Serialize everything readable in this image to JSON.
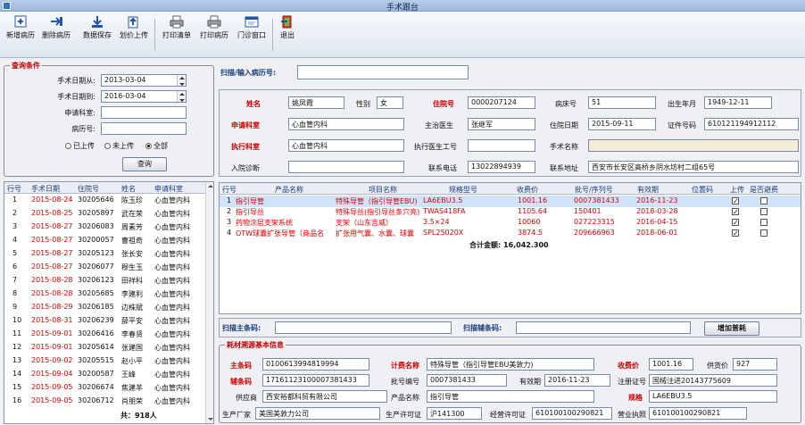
{
  "window": {
    "title": "手术跟台"
  },
  "toolbar": [
    {
      "label": "新增病历",
      "icon": "new-record-icon"
    },
    {
      "label": "删除病历",
      "icon": "delete-record-icon"
    },
    {
      "label": "数据保存",
      "icon": "save-data-icon"
    },
    {
      "label": "划价上传",
      "icon": "upload-pricing-icon"
    },
    {
      "label": "打印清单",
      "icon": "print-list-icon"
    },
    {
      "label": "打印病历",
      "icon": "print-record-icon"
    },
    {
      "label": "门诊窗口",
      "icon": "outpatient-window-icon"
    },
    {
      "label": "退出",
      "icon": "exit-icon"
    }
  ],
  "query": {
    "legend": "查询条件",
    "date_from_label": "手术日期从:",
    "date_from": "2013-03-04",
    "date_to_label": "手术日期到:",
    "date_to": "2016-03-04",
    "dept_label": "申请科室:",
    "dept": "",
    "record_label": "病历号:",
    "record": "",
    "radio_uploaded": "已上传",
    "radio_not_uploaded": "未上传",
    "radio_all": "全部",
    "selected": "全部",
    "search_button": "查询"
  },
  "surgery_list": {
    "headers": [
      "行号",
      "手术日期",
      "住院号",
      "姓名",
      "申请科室"
    ],
    "rows": [
      [
        "1",
        "2015-08-24",
        "30205646",
        "陈玉珍",
        "心血管内科"
      ],
      [
        "2",
        "2015-08-25",
        "30205897",
        "武在荣",
        "心血管内科"
      ],
      [
        "3",
        "2015-08-27",
        "30206083",
        "周素芳",
        "心血管内科"
      ],
      [
        "4",
        "2015-08-27",
        "30200057",
        "曹祖奇",
        "心血管内科"
      ],
      [
        "5",
        "2015-08-27",
        "30205123",
        "张长安",
        "心血管内科"
      ],
      [
        "6",
        "2015-08-27",
        "30206077",
        "穆生玉",
        "心血管内科"
      ],
      [
        "7",
        "2015-08-28",
        "30206123",
        "田祥科",
        "心血管内科"
      ],
      [
        "8",
        "2015-08-28",
        "30205685",
        "李建利",
        "心血管内科"
      ],
      [
        "9",
        "2015-08-29",
        "30206185",
        "边株斌",
        "心血管内科"
      ],
      [
        "10",
        "2015-08-31",
        "30206239",
        "薛平安",
        "心血管内科"
      ],
      [
        "11",
        "2015-09-01",
        "30206416",
        "李春贤",
        "心血管内科"
      ],
      [
        "12",
        "2015-09-01",
        "30205614",
        "张建国",
        "心血管内科"
      ],
      [
        "13",
        "2015-09-02",
        "30205515",
        "赵小平",
        "心血管内科"
      ],
      [
        "14",
        "2015-09-04",
        "30200587",
        "王峰",
        "心血管内科"
      ],
      [
        "15",
        "2015-09-05",
        "30206674",
        "焦建羊",
        "心血管内科"
      ],
      [
        "16",
        "2015-09-05",
        "30206712",
        "肖朋荣",
        "心血管内科"
      ]
    ],
    "total": "共：918人"
  },
  "scan_record": {
    "label": "扫描/输入病历号:",
    "value": ""
  },
  "patient": {
    "name_label": "姓名",
    "name": "姚凤霞",
    "sex_label": "性别",
    "sex": "女",
    "inpatient_label": "住院号",
    "inpatient": "0000207124",
    "bed_label": "病床号",
    "bed": "51",
    "birth_label": "出生年月",
    "birth": "1949-12-11",
    "dept_label": "申请科室",
    "dept": "心血管内科",
    "doctor_label": "主治医生",
    "doctor": "张继军",
    "admit_label": "住院日期",
    "admit": "2015-09-11",
    "id_label": "证件号码",
    "id": "610121194912112",
    "exec_dept_label": "执行科室",
    "exec_dept": "心血管内科",
    "exec_doc_label": "执行医生工号",
    "exec_doc": "",
    "surgery_label": "手术名称",
    "surgery": "",
    "diag_label": "入院诊断",
    "diag": "",
    "phone_label": "联系电话",
    "phone": "13022894939",
    "addr_label": "联系地址",
    "addr": "西安市长安区高桥乡阴水坊村二组65号"
  },
  "items": {
    "headers": [
      "行号",
      "产品名称",
      "项目名称",
      "规格型号",
      "收费价",
      "批号/序列号",
      "有效期",
      "位置码",
      "上传",
      "是否避费"
    ],
    "rows": [
      {
        "no": "1",
        "product": "指引导管",
        "project": "特殊导管（指引导管EBU)",
        "spec": "LA6EBU3.5",
        "price": "1001.16",
        "lot": "0007381433",
        "expiry": "2016-11-23",
        "loc": "",
        "uploaded": true,
        "waived": false
      },
      {
        "no": "2",
        "product": "指引导丝",
        "project": "特殊导丝(指引导丝条穴亮)",
        "spec": "TWAS418FA",
        "price": "1105.64",
        "lot": "150401",
        "expiry": "2018-03-28",
        "loc": "",
        "uploaded": true,
        "waived": false
      },
      {
        "no": "3",
        "product": "药物涂层支架系统",
        "project": "支架（山东吉威）",
        "spec": "3.5×24",
        "price": "10060",
        "lot": "027223315",
        "expiry": "2016-04-15",
        "loc": "",
        "uploaded": true,
        "waived": false
      },
      {
        "no": "4",
        "product": "OTW球囊扩张导管（商品名",
        "project": "扩张用气囊、水囊、球囊",
        "spec": "SPL25020X",
        "price": "3874.5",
        "lot": "209666963",
        "expiry": "2018-06-01",
        "loc": "",
        "uploaded": true,
        "waived": false
      }
    ],
    "total_label": "合计金额:",
    "total": "16,042.300"
  },
  "scan_bar": {
    "main_label": "扫描主条码:",
    "main_value": "",
    "aux_label": "扫描辅条码:",
    "aux_value": "",
    "add_button": "增加普耗"
  },
  "consumable": {
    "legend": "耗材溯源基本信息",
    "code_label": "主条码",
    "code": "0100613994819994",
    "charge_name_label": "计费名称",
    "charge_name": "特殊导管（指引导管EBU美敦力)",
    "price_label": "收费价",
    "price": "1001.16",
    "supply_price_label": "供货价",
    "supply_price": "927",
    "aux_code_label": "辅条码",
    "aux_code": "17161123100007381433",
    "lot_label": "批号编号",
    "lot": "0007381433",
    "expiry_label": "有效期",
    "expiry": "2016-11-23",
    "reg_label": "注册证号",
    "reg": "国械注进20143775609",
    "supplier_label": "供应商",
    "supplier": "西安裕都科贸有限公司",
    "product_label": "产品名称",
    "product": "指引导管",
    "spec_label": "规格",
    "spec": "LA6EBU3.5",
    "maker_label": "生产厂家",
    "maker": "美国美敦力公司",
    "prod_lic_label": "生产许可证",
    "prod_lic": "沪141300",
    "biz_lic_label": "经营许可证",
    "biz_lic": "610100100290821",
    "license_label": "营业执照",
    "license": "610100100290821"
  },
  "colors": {
    "accent_red": "#e00000",
    "selected_row": "#cfe3fb",
    "title": "#0a2a55"
  }
}
